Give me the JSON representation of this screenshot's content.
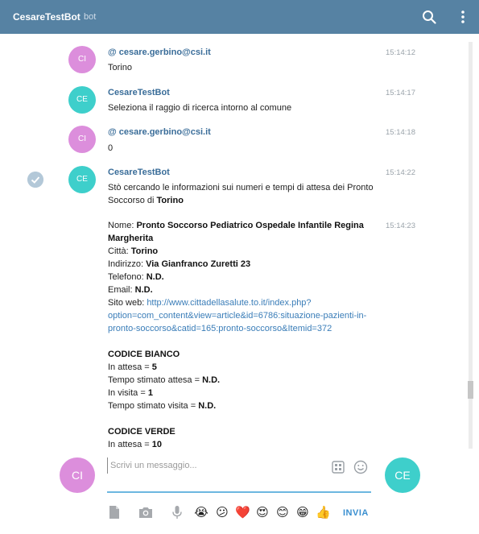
{
  "header": {
    "title": "CesareTestBot",
    "subtitle": "bot"
  },
  "messages": [
    {
      "sender": "@ cesare.gerbino@csi.it",
      "avatar": "CI",
      "time": "15:14:12",
      "text": "Torino"
    },
    {
      "sender": "CesareTestBot",
      "avatar": "CE",
      "time": "15:14:17",
      "text": "Seleziona il raggio di ricerca intorno al comune"
    },
    {
      "sender": "@ cesare.gerbino@csi.it",
      "avatar": "CI",
      "time": "15:14:18",
      "text": "0"
    },
    {
      "sender": "CesareTestBot",
      "avatar": "CE",
      "time": "15:14:22",
      "text_a": "Stò cercando le informazioni sui numeri e tempi di attesa dei Pronto",
      "text_b": "Soccorso di ",
      "text_b_bold": "Torino"
    }
  ],
  "detail": {
    "time": "15:14:23",
    "name_label": "Nome: ",
    "name_value_1": "Pronto Soccorso Pediatrico Ospedale Infantile Regina",
    "name_value_2": "Margherita",
    "city_label": "Città: ",
    "city_value": "Torino",
    "address_label": "Indirizzo: ",
    "address_value": "Via Gianfranco Zuretti 23",
    "phone_label": "Telefono: ",
    "phone_value": "N.D.",
    "email_label": "Email: ",
    "email_value": "N.D.",
    "site_label": "Sito web: ",
    "site_url_1": "http://www.cittadellasalute.to.it/index.php?",
    "site_url_2": "option=com_content&view=article&id=6786:situazione-pazienti-in-",
    "site_url_3": "pronto-soccorso&catid=165:pronto-soccorso&Itemid=372",
    "white_title": "CODICE BIANCO",
    "white_waiting_label": "In attesa = ",
    "white_waiting_value": "5",
    "white_est_wait_label": "Tempo stimato attesa = ",
    "white_est_wait_value": "N.D.",
    "white_visit_label": "In visita = ",
    "white_visit_value": "1",
    "white_est_visit_label": "Tempo stimato visita = ",
    "white_est_visit_value": "N.D.",
    "green_title": "CODICE VERDE",
    "green_waiting_label": "In attesa = ",
    "green_waiting_value": "10"
  },
  "composer": {
    "placeholder": "Scrivi un messaggio...",
    "left_avatar": "CI",
    "right_avatar": "CE",
    "send_label": "INVIA",
    "emojis": [
      "😭",
      "😕",
      "❤️",
      "😍",
      "😊",
      "😁",
      "👍"
    ]
  },
  "colors": {
    "header": "#5682a3",
    "sender": "#3a6d99",
    "ci_avatar": "#dc8edc",
    "ce_avatar": "#3ecfcb",
    "send": "#3a8fd0"
  }
}
